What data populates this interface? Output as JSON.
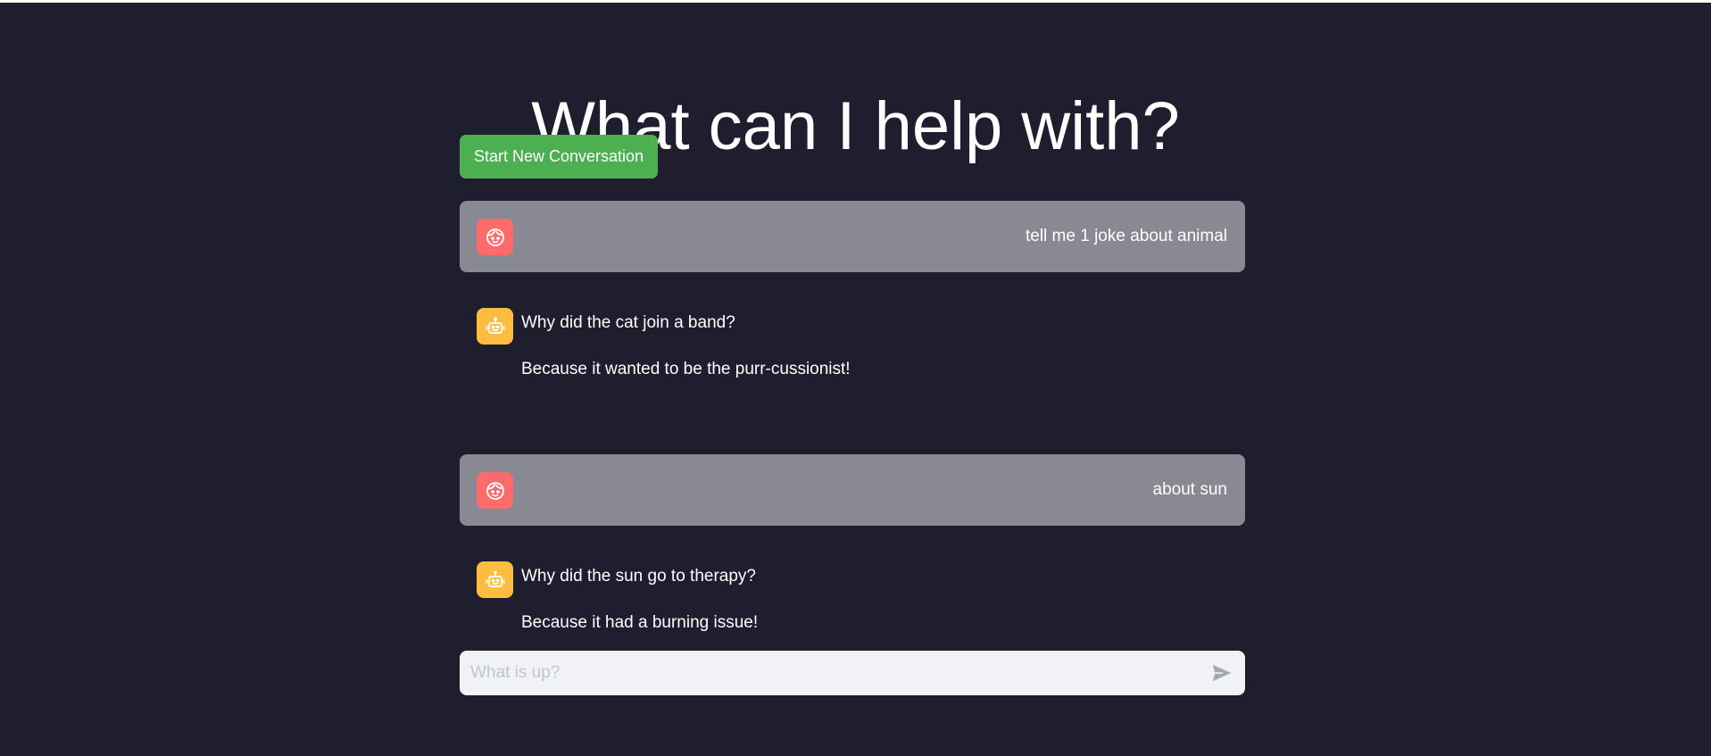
{
  "page": {
    "title": "What can I help with?"
  },
  "actions": {
    "new_conversation_label": "Start New Conversation"
  },
  "messages": [
    {
      "role": "user",
      "avatar_icon": "user-face-icon",
      "text": "tell me 1 joke about animal"
    },
    {
      "role": "assistant",
      "avatar_icon": "robot-icon",
      "lines": [
        "Why did the cat join a band?",
        "Because it wanted to be the purr-cussionist!"
      ]
    },
    {
      "role": "user",
      "avatar_icon": "user-face-icon",
      "text": "about sun"
    },
    {
      "role": "assistant",
      "avatar_icon": "robot-icon",
      "lines": [
        "Why did the sun go to therapy?",
        "Because it had a burning issue!"
      ]
    }
  ],
  "chat_input": {
    "placeholder": "What is up?",
    "value": "",
    "send_icon": "send-icon"
  },
  "colors": {
    "background": "#1f1e2e",
    "user_bubble": "#898993",
    "user_avatar": "#ff6b6b",
    "assistant_avatar": "#fdbd41",
    "new_conversation_button": "#4caf50",
    "input_background": "#f0f2f6"
  }
}
